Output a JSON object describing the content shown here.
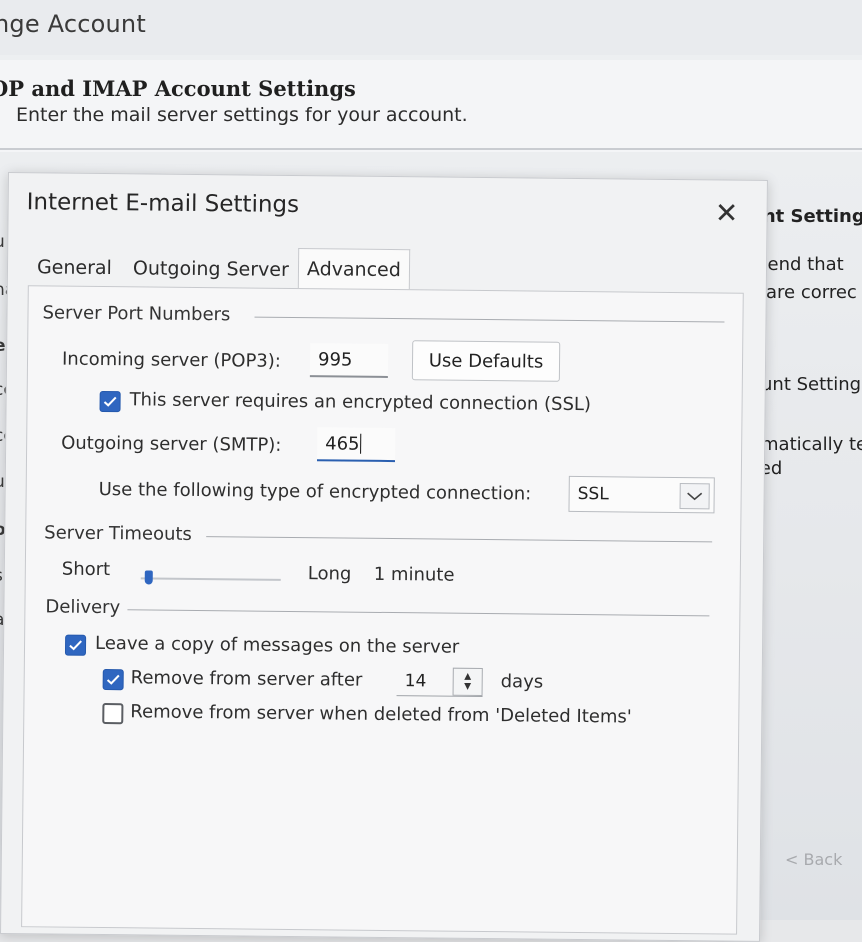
{
  "background_window": {
    "title": "nge Account",
    "heading": "OP and IMAP Account Settings",
    "subheading": "Enter the mail server settings for your account.",
    "left_fragments": [
      "u",
      "na",
      "er",
      "cc",
      "cc",
      "ut",
      "og",
      "se",
      "as"
    ],
    "right_fragments": [
      "unt Setting",
      "mend that",
      "are correc",
      "ount Setting",
      "omatically te",
      "ked"
    ],
    "back_label": "< Back"
  },
  "dialog": {
    "title": "Internet E-mail Settings",
    "tabs": [
      {
        "label": "General",
        "active": false
      },
      {
        "label": "Outgoing Server",
        "active": false
      },
      {
        "label": "Advanced",
        "active": true
      }
    ],
    "server_ports": {
      "group_label": "Server Port Numbers",
      "incoming_label": "Incoming server (POP3):",
      "incoming_value": "995",
      "use_defaults_label": "Use Defaults",
      "ssl_checkbox_label": "This server requires an encrypted connection (SSL)",
      "ssl_checked": true,
      "outgoing_label": "Outgoing server (SMTP):",
      "outgoing_value": "465",
      "encryption_label": "Use the following type of encrypted connection:",
      "encryption_value": "SSL"
    },
    "timeouts": {
      "group_label": "Server Timeouts",
      "short_label": "Short",
      "long_label": "Long",
      "value_label": "1 minute",
      "slider_level": 0.03
    },
    "delivery": {
      "group_label": "Delivery",
      "leave_copy_label": "Leave a copy of messages on the server",
      "leave_copy_checked": true,
      "remove_after_label": "Remove from server after",
      "remove_after_checked": true,
      "remove_after_days": "14",
      "days_label": "days",
      "remove_deleted_label": "Remove from server when deleted from 'Deleted Items'",
      "remove_deleted_checked": false
    }
  },
  "colors": {
    "accent": "#2f66c0",
    "dialog_bg": "#f1f2f3"
  }
}
